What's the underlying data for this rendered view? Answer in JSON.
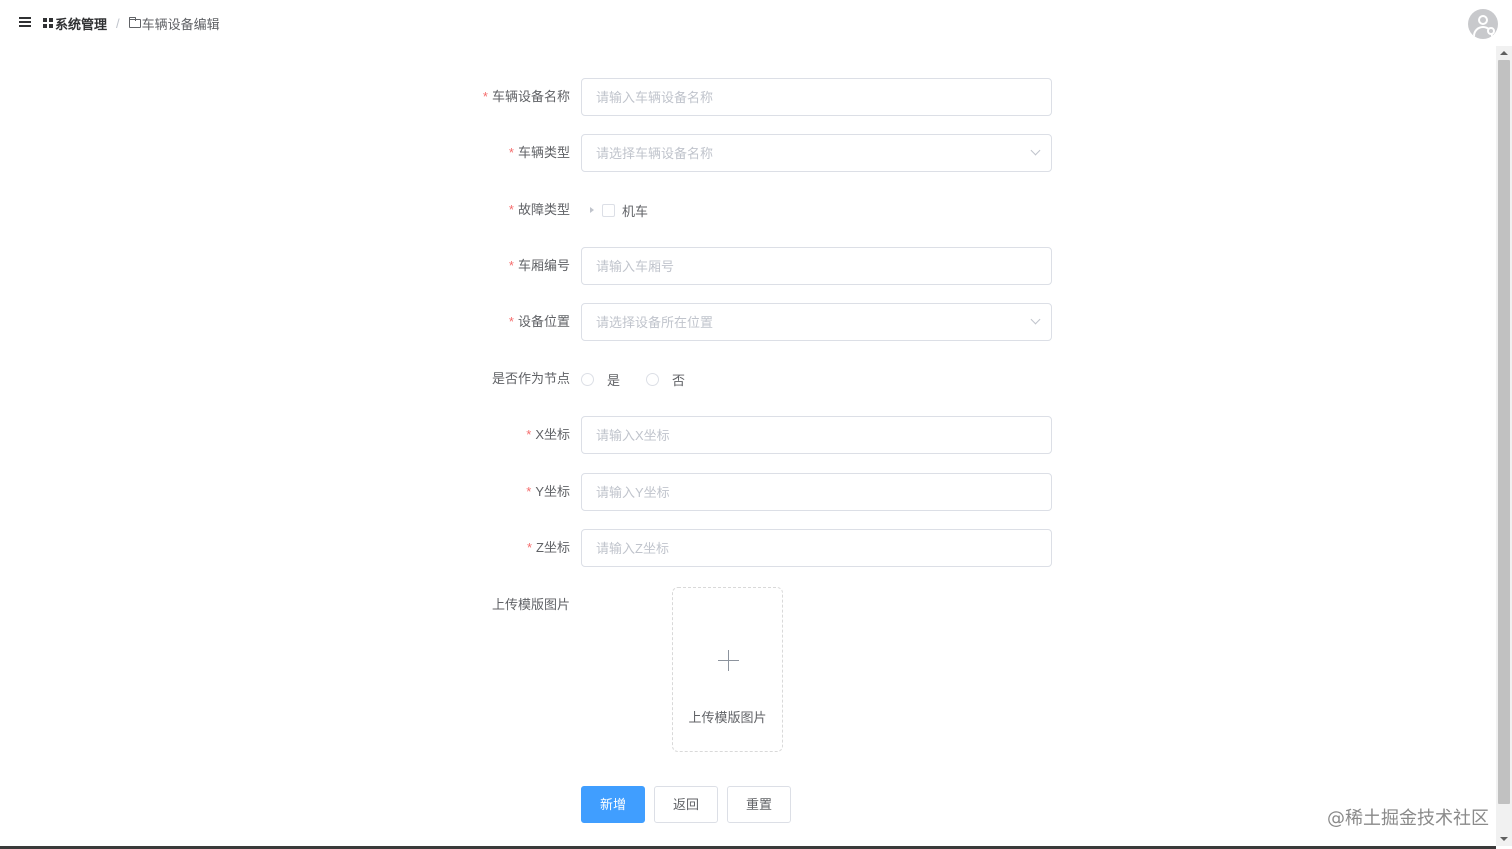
{
  "header": {
    "breadcrumb": {
      "root": "系统管理",
      "separator": "/",
      "current": "车辆设备编辑"
    },
    "icons": {
      "menu": "hamburger-icon",
      "root": "grid-icon",
      "current": "folder-icon",
      "user": "user-avatar-icon"
    }
  },
  "form": {
    "required_mark": "*",
    "device_name": {
      "label": "车辆设备名称",
      "placeholder": "请输入车辆设备名称",
      "value": ""
    },
    "vehicle_type": {
      "label": "车辆类型",
      "placeholder": "请选择车辆设备名称",
      "value": ""
    },
    "fault_type": {
      "label": "故障类型",
      "tree_item": "机车",
      "checked": false
    },
    "carriage_no": {
      "label": "车厢编号",
      "placeholder": "请输入车厢号",
      "value": ""
    },
    "device_position": {
      "label": "设备位置",
      "placeholder": "请选择设备所在位置",
      "value": ""
    },
    "is_node": {
      "label": "是否作为节点",
      "options": [
        "是",
        "否"
      ],
      "selected": null
    },
    "x_coord": {
      "label": "X坐标",
      "placeholder": "请输入X坐标",
      "value": ""
    },
    "y_coord": {
      "label": "Y坐标",
      "placeholder": "请输入Y坐标",
      "value": ""
    },
    "z_coord": {
      "label": "Z坐标",
      "placeholder": "请输入Z坐标",
      "value": ""
    },
    "upload": {
      "label": "上传模版图片",
      "button_text": "上传模版图片"
    }
  },
  "buttons": {
    "submit": "新增",
    "back": "返回",
    "reset": "重置"
  },
  "colors": {
    "primary": "#409eff",
    "required": "#f56c6c",
    "border": "#dcdfe6",
    "placeholder": "#c0c4cc"
  },
  "watermark": "@稀土掘金技术社区"
}
